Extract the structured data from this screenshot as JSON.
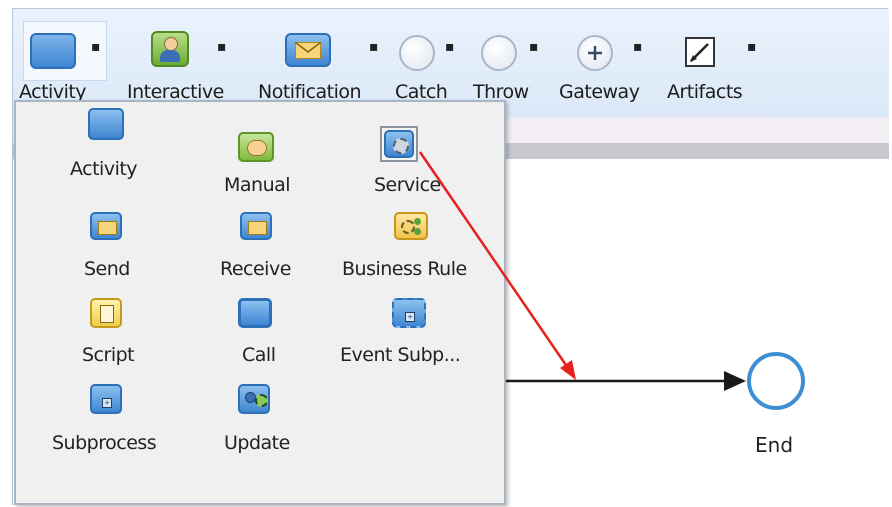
{
  "toolbar": {
    "items": [
      {
        "label": "Activity",
        "icon": "activity-icon"
      },
      {
        "label": "Interactive",
        "icon": "interactive-user-icon"
      },
      {
        "label": "Notification",
        "icon": "envelope-icon"
      },
      {
        "label": "Catch",
        "icon": "catch-event-icon"
      },
      {
        "label": "Throw",
        "icon": "throw-event-icon"
      },
      {
        "label": "Gateway",
        "icon": "gateway-plus-icon"
      },
      {
        "label": "Artifacts",
        "icon": "artifact-pencil-icon"
      }
    ],
    "dropdown_glyph": "▪"
  },
  "palette": {
    "items": [
      {
        "label": "Activity",
        "icon": "activity-icon"
      },
      {
        "label": "Manual",
        "icon": "manual-hand-icon"
      },
      {
        "label": "Service",
        "icon": "service-gear-icon"
      },
      {
        "label": "Send",
        "icon": "send-envelope-icon"
      },
      {
        "label": "Receive",
        "icon": "receive-envelope-icon"
      },
      {
        "label": "Business Rule",
        "icon": "business-rule-icon"
      },
      {
        "label": "Script",
        "icon": "script-scroll-icon"
      },
      {
        "label": "Call",
        "icon": "call-icon"
      },
      {
        "label": "Event Subp...",
        "icon": "event-subprocess-icon"
      },
      {
        "label": "Subprocess",
        "icon": "subprocess-icon"
      },
      {
        "label": "Update",
        "icon": "update-icon"
      }
    ]
  },
  "canvas": {
    "end_event_label": "End"
  },
  "colors": {
    "accent_blue": "#3e8fd2",
    "annotation_arrow": "#e8201d",
    "flow_line": "#1a1a1a"
  }
}
